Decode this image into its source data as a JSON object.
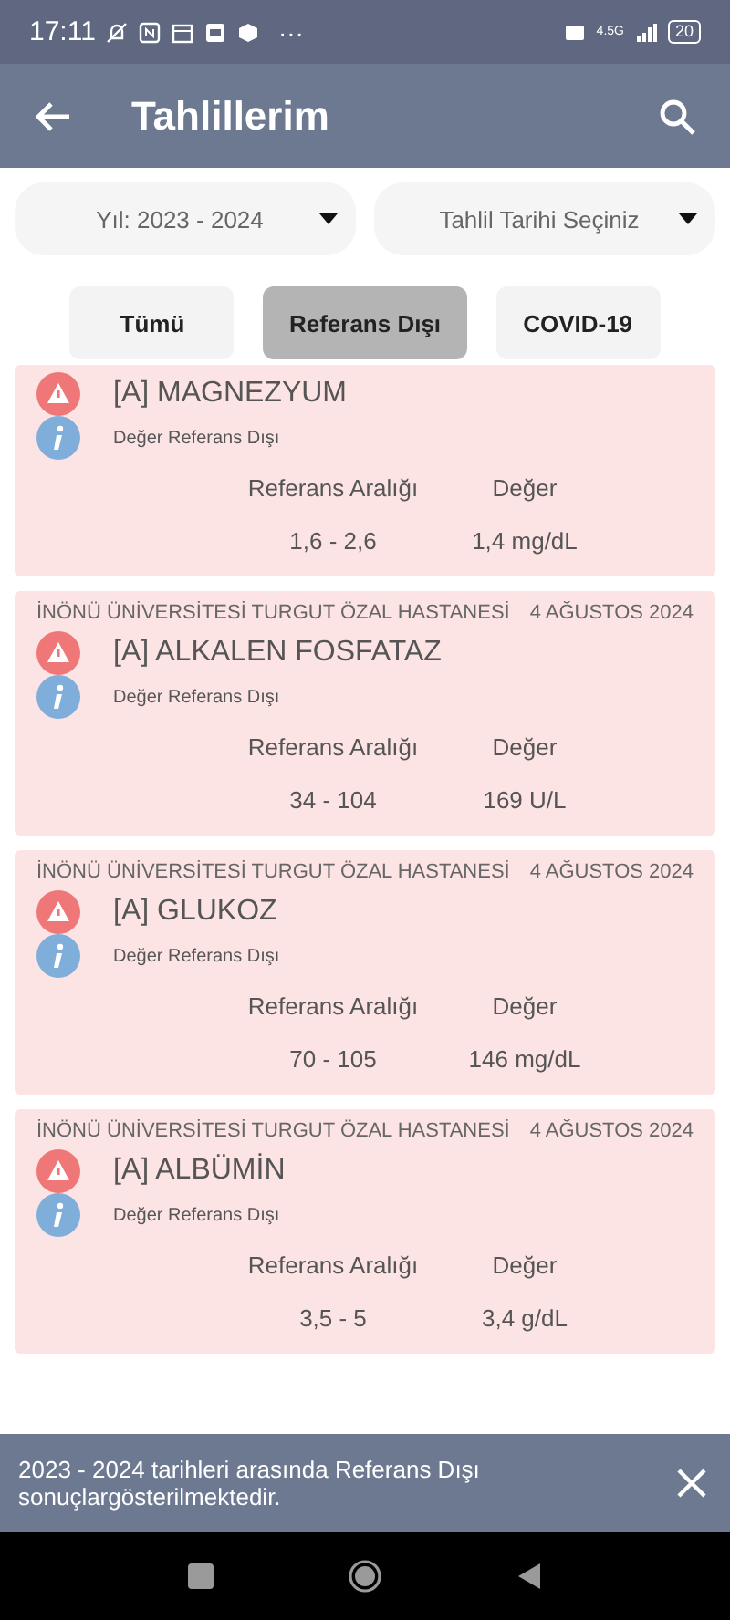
{
  "status_bar": {
    "time": "17:11",
    "more": "···",
    "network": "4.5G",
    "battery": "20"
  },
  "app_bar": {
    "title": "Tahlillerim"
  },
  "filters": [
    {
      "value": "Yıl: 2023 - 2024"
    },
    {
      "placeholder": "Tahlil Tarihi Seçiniz"
    }
  ],
  "tabs": [
    {
      "label": "Tümü",
      "selected": false
    },
    {
      "label": "Referans Dışı",
      "selected": true
    },
    {
      "label": "COVID-19",
      "selected": false
    }
  ],
  "results": [
    {
      "test": "[A] MAGNEZYUM",
      "status": "Değer Referans Dışı",
      "range_label": "Referans Aralığı",
      "value_label": "Değer",
      "range": "1,6 - 2,6",
      "value": "1,4 mg/dL"
    },
    {
      "hospital": "İNÖNÜ ÜNİVERSİTESİ TURGUT ÖZAL  HASTANESİ",
      "date": "4 AĞUSTOS 2024",
      "test": "[A] ALKALEN FOSFATAZ",
      "status": "Değer Referans Dışı",
      "range_label": "Referans Aralığı",
      "value_label": "Değer",
      "range": "34 - 104",
      "value": "169 U/L"
    },
    {
      "hospital": "İNÖNÜ ÜNİVERSİTESİ TURGUT ÖZAL  HASTANESİ",
      "date": "4 AĞUSTOS 2024",
      "test": "[A] GLUKOZ",
      "status": "Değer Referans Dışı",
      "range_label": "Referans Aralığı",
      "value_label": "Değer",
      "range": "70 - 105",
      "value": "146 mg/dL"
    },
    {
      "hospital": "İNÖNÜ ÜNİVERSİTESİ TURGUT ÖZAL  HASTANESİ",
      "date": "4 AĞUSTOS 2024",
      "test": "[A] ALBÜMİN",
      "status": "Değer Referans Dışı",
      "range_label": "Referans Aralığı",
      "value_label": "Değer",
      "range": "3,5 - 5",
      "value": "3,4 g/dL"
    }
  ],
  "snackbar": {
    "message": "2023 - 2024 tarihleri arasında Referans Dışı sonuçlargösterilmektedir."
  }
}
